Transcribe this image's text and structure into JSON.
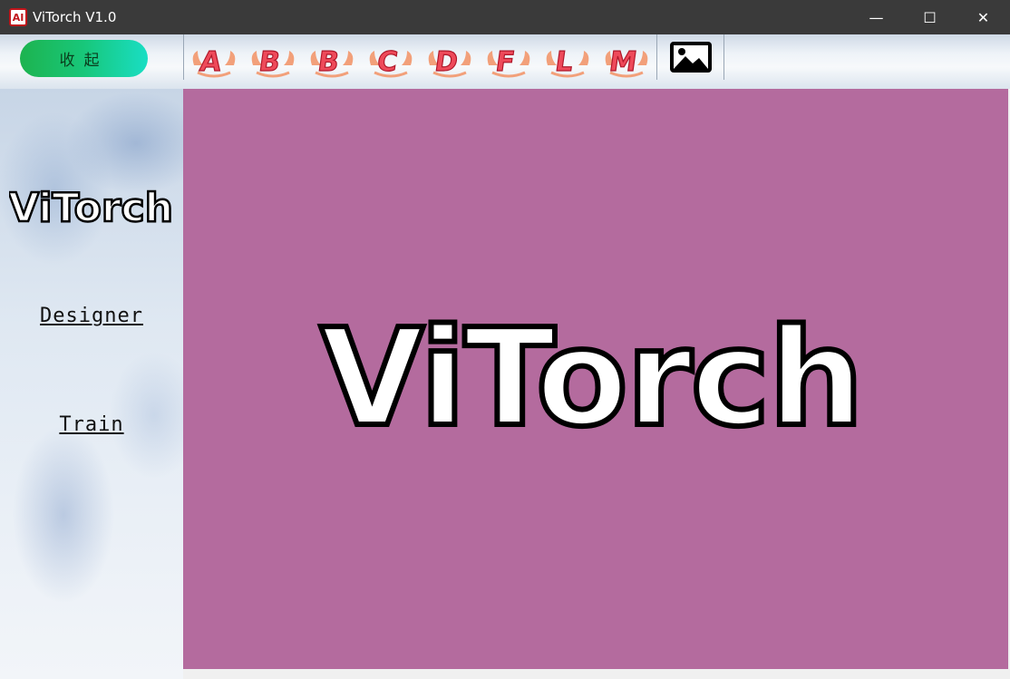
{
  "window": {
    "title": "ViTorch V1.0",
    "icon_text": "AI",
    "controls": {
      "minimize": "—",
      "maximize": "☐",
      "close": "✕"
    }
  },
  "toolbar": {
    "collapse_label": "收起",
    "letter_buttons": [
      "A",
      "B",
      "B",
      "C",
      "D",
      "F",
      "L",
      "M"
    ],
    "image_button_icon": "image-icon"
  },
  "sidebar": {
    "logo_text": "ViTorch",
    "links": [
      "Designer",
      "Train"
    ]
  },
  "main": {
    "logo_text": "ViTorch",
    "background_color": "#b46b9e"
  },
  "colors": {
    "titlebar": "#3a3a3a",
    "collapse_button": "#18c77a",
    "letter_icon": "#e23a4a",
    "canvas": "#b46b9e"
  }
}
